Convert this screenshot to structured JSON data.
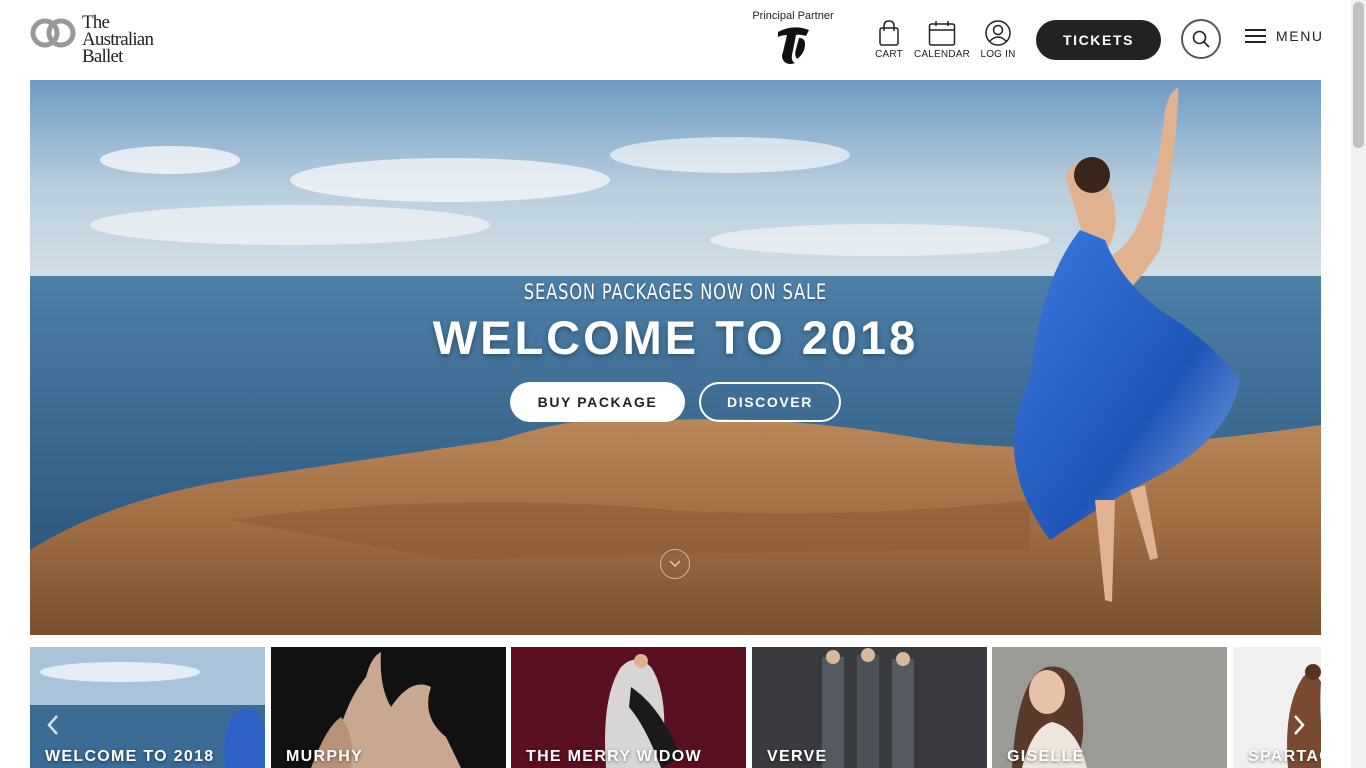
{
  "brand": {
    "logo_lines": [
      "The",
      "Australian",
      "Ballet"
    ],
    "partner_label": "Principal Partner",
    "partner_logo_icon": "telstra-t-icon"
  },
  "nav": {
    "cart_label": "CART",
    "calendar_label": "CALENDAR",
    "login_label": "LOG IN",
    "tickets_label": "TICKETS",
    "search_icon": "search-icon",
    "menu_icon": "hamburger-icon",
    "menu_label": "MENU"
  },
  "hero": {
    "eyebrow": "SEASON PACKAGES NOW ON SALE",
    "title": "WELCOME TO 2018",
    "primary_button": "BUY PACKAGE",
    "secondary_button": "DISCOVER",
    "scroll_icon": "chevron-down-icon"
  },
  "carousel": {
    "prev_icon": "chevron-left-icon",
    "next_icon": "chevron-right-icon",
    "items": [
      {
        "title": "WELCOME TO 2018"
      },
      {
        "title": "MURPHY"
      },
      {
        "title": "THE MERRY WIDOW"
      },
      {
        "title": "VERVE"
      },
      {
        "title": "GISELLE"
      },
      {
        "title": "SPARTACUS"
      }
    ]
  },
  "colors": {
    "dark": "#222222",
    "white": "#ffffff",
    "merry_widow_bg": "#5a1020"
  }
}
